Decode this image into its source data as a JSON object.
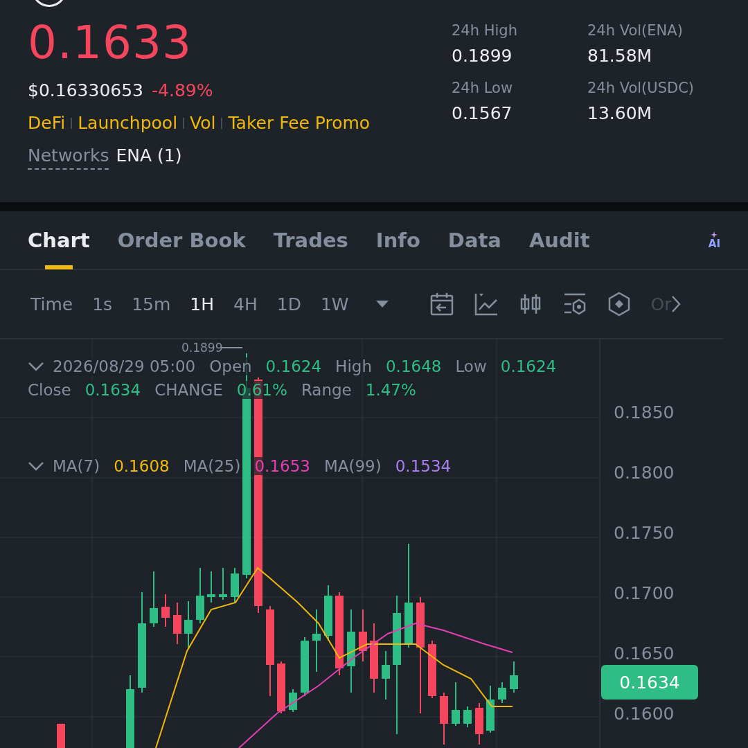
{
  "header": {
    "price": "0.1633",
    "usd_price": "$0.16330653",
    "change": "-4.89%",
    "tags": [
      "DeFi",
      "Launchpool",
      "Vol",
      "Taker Fee Promo"
    ],
    "networks_label": "Networks",
    "networks_value": "ENA (1)"
  },
  "stats": [
    {
      "label": "24h High",
      "value": "0.1899"
    },
    {
      "label": "24h Vol(ENA)",
      "value": "81.58M"
    },
    {
      "label": "24h Low",
      "value": "0.1567"
    },
    {
      "label": "24h Vol(USDC)",
      "value": "13.60M"
    }
  ],
  "tabs": [
    {
      "label": "Chart",
      "selected": true
    },
    {
      "label": "Order Book",
      "selected": false
    },
    {
      "label": "Trades",
      "selected": false
    },
    {
      "label": "Info",
      "selected": false
    },
    {
      "label": "Data",
      "selected": false
    },
    {
      "label": "Audit",
      "selected": false
    }
  ],
  "ai_button": "AI",
  "intervals": [
    {
      "label": "Time",
      "selected": false
    },
    {
      "label": "1s",
      "selected": false
    },
    {
      "label": "15m",
      "selected": false
    },
    {
      "label": "1H",
      "selected": true
    },
    {
      "label": "4H",
      "selected": false
    },
    {
      "label": "1D",
      "selected": false
    },
    {
      "label": "1W",
      "selected": false
    }
  ],
  "toolbar_more": "Or",
  "legend": {
    "date": "2026/08/29 05:00",
    "items": [
      {
        "label": "Open",
        "value": "0.1624"
      },
      {
        "label": "High",
        "value": "0.1648"
      },
      {
        "label": "Low",
        "value": "0.1624"
      },
      {
        "label": "Close",
        "value": "0.1634"
      },
      {
        "label": "CHANGE",
        "value": "0.61%"
      },
      {
        "label": "Range",
        "value": "1.47%"
      }
    ]
  },
  "moving_averages": [
    {
      "label": "MA(7)",
      "value": "0.1608",
      "color": "#f0b90b"
    },
    {
      "label": "MA(25)",
      "value": "0.1653",
      "color": "#e040b0"
    },
    {
      "label": "MA(99)",
      "value": "0.1534",
      "color": "#a77ff0"
    }
  ],
  "high_marker": "0.1899",
  "price_axis": [
    "0.1850",
    "0.1800",
    "0.1750",
    "0.1700",
    "0.1650",
    "0.1600"
  ],
  "current_price": "0.1634"
}
